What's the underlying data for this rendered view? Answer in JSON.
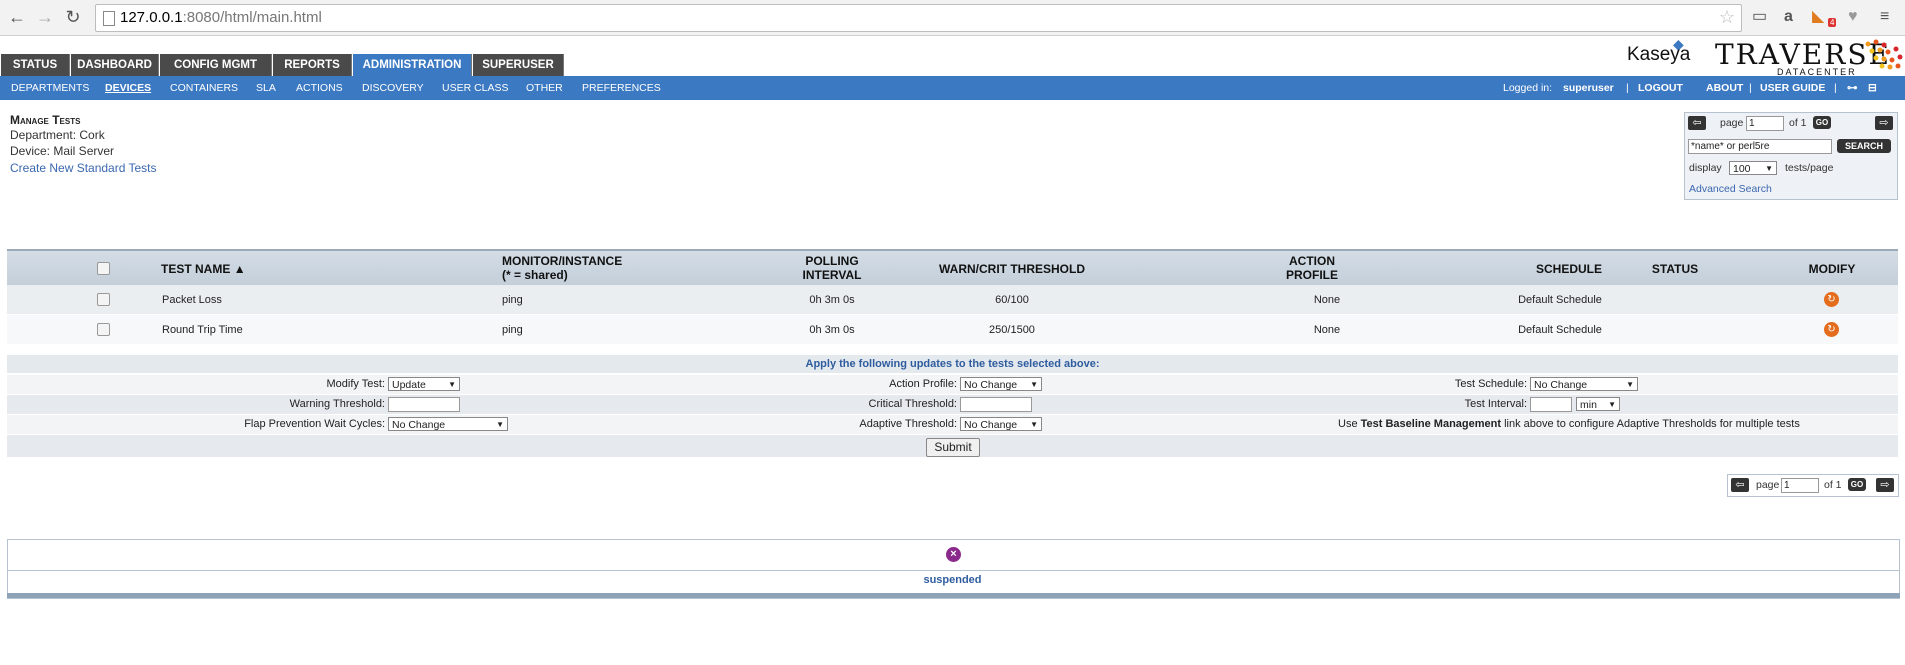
{
  "browser": {
    "url_host": "127.0.0.1",
    "url_rest": ":8080/html/main.html",
    "badge_count": "4"
  },
  "brand": {
    "kaseya": "Kaseya",
    "traverse": "TRAVERSE",
    "datacenter": "DATACENTER"
  },
  "tabs": [
    "STATUS",
    "DASHBOARD",
    "CONFIG MGMT",
    "REPORTS",
    "ADMINISTRATION",
    "SUPERUSER"
  ],
  "subnav": {
    "items": [
      "DEPARTMENTS",
      "DEVICES",
      "CONTAINERS",
      "SLA",
      "ACTIONS",
      "DISCOVERY",
      "USER CLASS",
      "OTHER",
      "PREFERENCES"
    ],
    "logged_in_label": "Logged in:",
    "username": "superuser",
    "sep": "|",
    "logout": "LOGOUT",
    "about": "ABOUT",
    "user_guide": "USER GUIDE"
  },
  "page": {
    "title": "Manage Tests",
    "department": "Department: Cork",
    "device": "Device: Mail Server",
    "create_link": "Create New Standard Tests"
  },
  "search": {
    "page_label": "page",
    "page_value": "1",
    "of_label": "of 1",
    "go": "GO",
    "query": "*name* or perl5re",
    "search_btn": "SEARCH",
    "display_label": "display",
    "per_page": "100",
    "per_page_suffix": "tests/page",
    "advanced": "Advanced Search"
  },
  "table": {
    "headers": {
      "test_name": "TEST NAME",
      "monitor_1": "MONITOR/INSTANCE",
      "monitor_2": "(* = shared)",
      "polling_1": "POLLING",
      "polling_2": "INTERVAL",
      "warn": "WARN/CRIT THRESHOLD",
      "action_1": "ACTION",
      "action_2": "PROFILE",
      "schedule": "SCHEDULE",
      "status": "STATUS",
      "modify": "MODIFY"
    },
    "rows": [
      {
        "name": "Packet Loss",
        "monitor": "ping",
        "interval": "0h 3m 0s",
        "threshold": "60/100",
        "action": "None",
        "schedule": "Default Schedule",
        "status": ""
      },
      {
        "name": "Round Trip Time",
        "monitor": "ping",
        "interval": "0h 3m 0s",
        "threshold": "250/1500",
        "action": "None",
        "schedule": "Default Schedule",
        "status": ""
      }
    ]
  },
  "updates": {
    "title": "Apply the following updates to the tests selected above:",
    "modify_test_label": "Modify Test:",
    "modify_test_value": "Update",
    "action_profile_label": "Action Profile:",
    "action_profile_value": "No Change",
    "test_schedule_label": "Test Schedule:",
    "test_schedule_value": "No Change",
    "warning_label": "Warning Threshold:",
    "critical_label": "Critical Threshold:",
    "interval_label": "Test Interval:",
    "interval_unit": "min",
    "flap_label": "Flap Prevention Wait Cycles:",
    "flap_value": "No Change",
    "adaptive_label": "Adaptive Threshold:",
    "adaptive_value": "No Change",
    "note_pre": "Use ",
    "note_bold": "Test Baseline Management",
    "note_post": " link above to configure Adaptive Thresholds for multiple tests",
    "submit": "Submit"
  },
  "pager": {
    "page_label": "page",
    "page_value": "1",
    "of_label": "of 1",
    "go": "GO"
  },
  "suspended": {
    "label": "suspended"
  },
  "colors": {
    "blue_bar": "#3c79c3",
    "dark_tab": "#4a4a4a",
    "link": "#3b68b0",
    "modify_icon": "#e46c1d",
    "suspend_icon": "#8b2a8c"
  }
}
